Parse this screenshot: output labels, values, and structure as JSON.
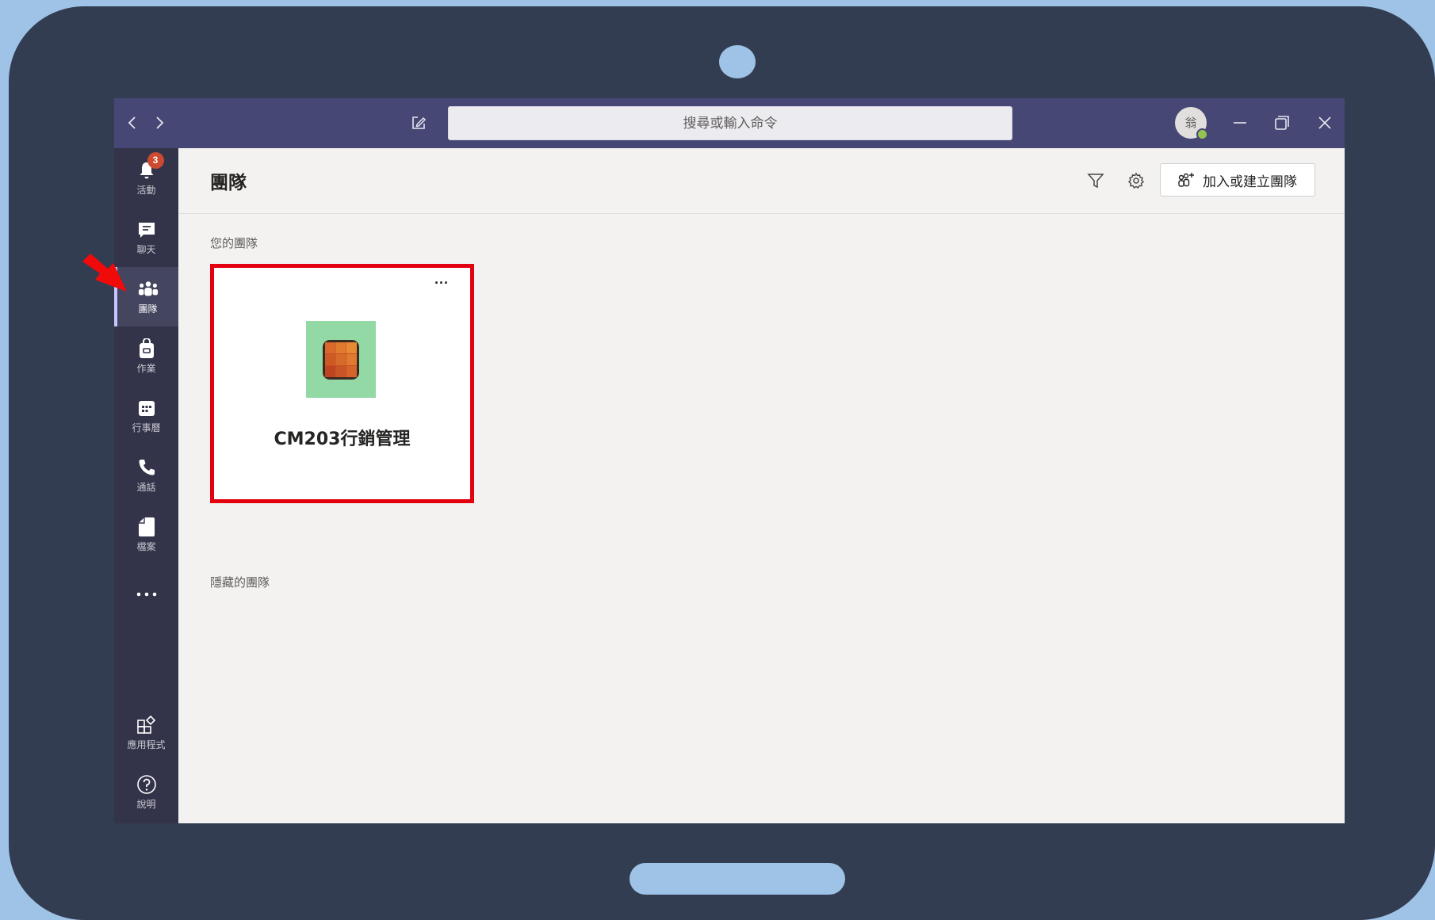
{
  "titlebar": {
    "search_placeholder": "搜尋或輸入命令",
    "avatar_initial": "翁"
  },
  "rail": {
    "items": [
      {
        "label": "活動",
        "icon": "bell-icon",
        "badge": "3"
      },
      {
        "label": "聊天",
        "icon": "chat-icon"
      },
      {
        "label": "團隊",
        "icon": "teams-icon",
        "active": true
      },
      {
        "label": "作業",
        "icon": "assignments-icon"
      },
      {
        "label": "行事曆",
        "icon": "calendar-icon"
      },
      {
        "label": "通話",
        "icon": "phone-icon"
      },
      {
        "label": "檔案",
        "icon": "file-icon"
      },
      {
        "label": "",
        "icon": "more-icon"
      },
      {
        "label": "應用程式",
        "icon": "apps-icon"
      },
      {
        "label": "說明",
        "icon": "help-icon"
      }
    ]
  },
  "main": {
    "title": "團隊",
    "join_button_label": "加入或建立團隊",
    "your_teams_label": "您的團隊",
    "hidden_teams_label": "隱藏的團隊",
    "team_card": {
      "name": "CM203行銷管理",
      "more_label": "···"
    }
  },
  "colors": {
    "titlebar": "#464775",
    "rail": "#33344a",
    "highlight_border": "#e3000f",
    "team_logo_bg": "#92d9a6",
    "badge": "#cc4a31"
  }
}
